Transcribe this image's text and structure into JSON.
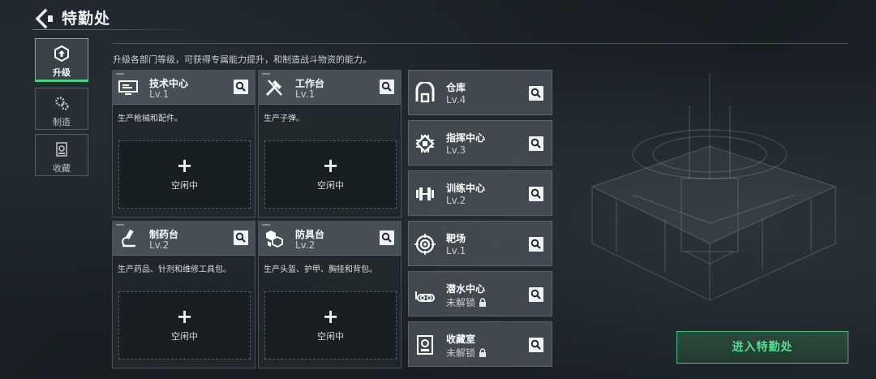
{
  "header": {
    "title": "特勤处"
  },
  "tabs": [
    {
      "label": "升级",
      "icon": "upgrade-icon",
      "active": true
    },
    {
      "label": "制造",
      "icon": "gears-icon",
      "active": false
    },
    {
      "label": "收藏",
      "icon": "collection-icon",
      "active": false
    }
  ],
  "description": "升级各部门等级，可获得专属能力提升，和制造战斗物资的能力。",
  "departments": [
    {
      "name": "技术中心",
      "level": "Lv.1",
      "desc": "生产枪械和配件。",
      "icon": "computer-icon",
      "slot_label": "空闲中"
    },
    {
      "name": "工作台",
      "level": "Lv.1",
      "desc": "生产子弹。",
      "icon": "tools-icon",
      "slot_label": "空闲中"
    },
    {
      "name": "制药台",
      "level": "Lv.2",
      "desc": "生产药品、针剂和维修工具包。",
      "icon": "microscope-icon",
      "slot_label": "空闲中"
    },
    {
      "name": "防具台",
      "level": "Lv.2",
      "desc": "生产头盔、护甲、胸挂和背包。",
      "icon": "armor-cubes-icon",
      "slot_label": "空闲中"
    }
  ],
  "facilities": [
    {
      "name": "仓库",
      "level": "Lv.4",
      "icon": "warehouse-icon",
      "locked": false
    },
    {
      "name": "指挥中心",
      "level": "Lv.3",
      "icon": "chip-icon",
      "locked": false
    },
    {
      "name": "训练中心",
      "level": "Lv.2",
      "icon": "dumbbell-icon",
      "locked": false
    },
    {
      "name": "靶场",
      "level": "Lv.1",
      "icon": "target-icon",
      "locked": false
    },
    {
      "name": "潜水中心",
      "level": "未解锁",
      "icon": "diving-goggles-icon",
      "locked": true
    },
    {
      "name": "收藏室",
      "level": "未解锁",
      "icon": "display-case-icon",
      "locked": true
    }
  ],
  "enter_button": "进入特勤处",
  "colors": {
    "accent_green": "#41d37e",
    "button_text": "#54e08f",
    "card_header": "#4a5258"
  }
}
